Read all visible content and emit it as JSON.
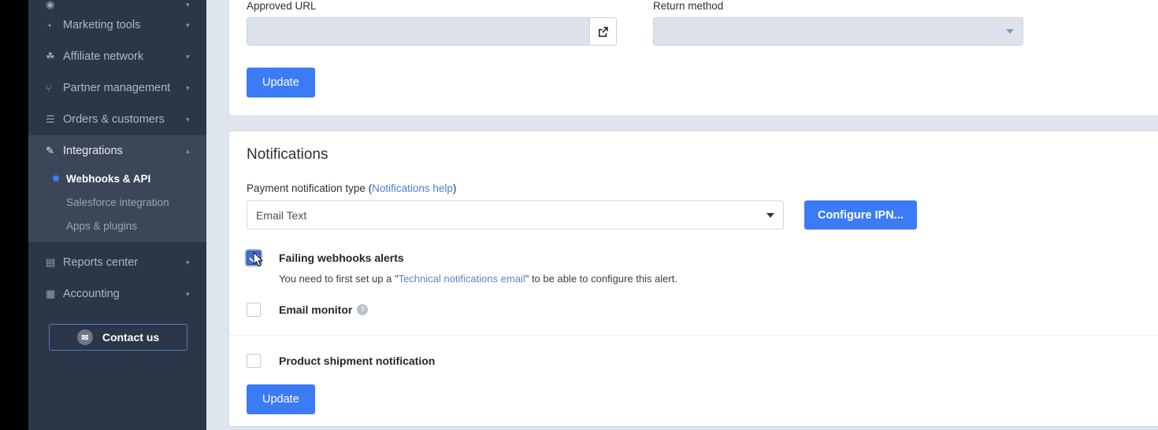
{
  "sidebar": {
    "items": [
      {
        "label": "Marketing tools",
        "icon": "pie-chart-icon",
        "caret": "▾",
        "glyph": "◔"
      },
      {
        "label": "Affiliate network",
        "icon": "handshake-icon",
        "caret": "▾",
        "glyph": "☘"
      },
      {
        "label": "Partner management",
        "icon": "org-chart-icon",
        "caret": "▾",
        "glyph": "⑂"
      },
      {
        "label": "Orders & customers",
        "icon": "clipboard-icon",
        "caret": "▾",
        "glyph": "☰"
      },
      {
        "label": "Integrations",
        "icon": "plug-icon",
        "caret": "▴",
        "glyph": "✎"
      },
      {
        "label": "Reports center",
        "icon": "bar-chart-icon",
        "caret": "▾",
        "glyph": "▤"
      },
      {
        "label": "Accounting",
        "icon": "ledger-icon",
        "caret": "▾",
        "glyph": "▦"
      }
    ],
    "sub_items": [
      {
        "label": "Webhooks & API",
        "selected": true
      },
      {
        "label": "Salesforce integration",
        "selected": false
      },
      {
        "label": "Apps & plugins",
        "selected": false
      }
    ],
    "contact_button": {
      "label": "Contact us",
      "icon": "envelope-icon",
      "glyph": "✉"
    },
    "accent_color": "#3d7bf7",
    "background_color": "#2b3648",
    "active_background_color": "#3b4759"
  },
  "top_panel": {
    "approved_url": {
      "label": "Approved URL",
      "value": "",
      "placeholder": "",
      "append_button_icon": "external-link-icon",
      "disabled": true
    },
    "return_method": {
      "label": "Return method",
      "value": "",
      "disabled": true,
      "caret": "▾"
    },
    "update_button": {
      "label": "Update"
    }
  },
  "notifications": {
    "title": "Notifications",
    "payment_notification_type": {
      "label_prefix": "Payment notification type (",
      "help_link": "Notifications help",
      "label_suffix": ")",
      "value": "Email Text",
      "caret": "▾"
    },
    "configure_ipn_button": {
      "label": "Configure IPN..."
    },
    "checkboxes": [
      {
        "label": "Failing webhooks alerts",
        "checked": true,
        "hint_before": "You need to first set up a \"",
        "hint_link": "Technical notifications email",
        "hint_after": "\" to be able to configure this alert."
      },
      {
        "label": "Email monitor",
        "checked": false,
        "help_icon": "question-mark-icon",
        "help_glyph": "?"
      },
      {
        "label": "Product shipment notification",
        "checked": false
      }
    ],
    "update_button": {
      "label": "Update"
    }
  },
  "colors": {
    "primary_button": "#3b7bf6",
    "link": "#4a7ed8",
    "page_background": "#dfe5ee",
    "panel_background": "#ffffff"
  }
}
